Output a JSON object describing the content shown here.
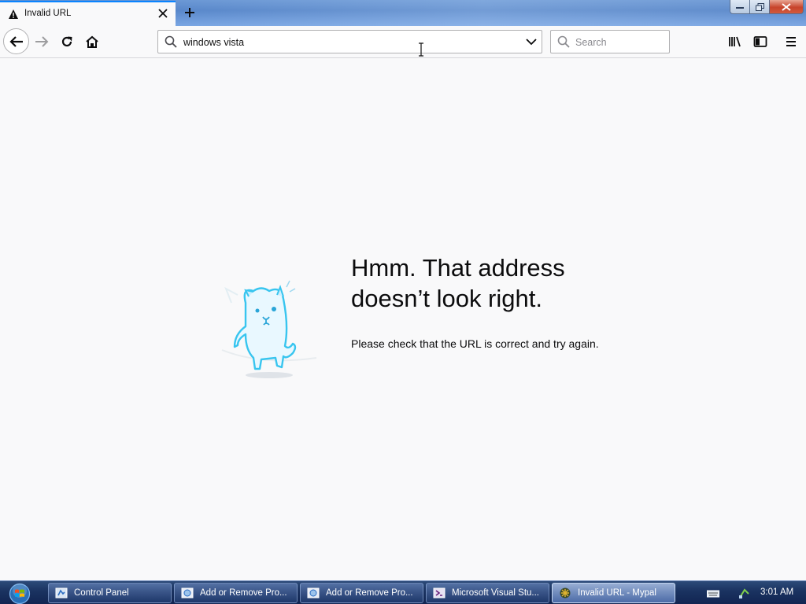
{
  "browser": {
    "tab": {
      "title": "Invalid URL"
    },
    "urlbar": {
      "value": "windows vista"
    },
    "search": {
      "placeholder": "Search"
    }
  },
  "error_page": {
    "heading": "Hmm. That address doesn’t look right.",
    "description": "Please check that the URL is correct and try again."
  },
  "taskbar": {
    "buttons": [
      {
        "label": "Control Panel",
        "icon": "control-panel-icon"
      },
      {
        "label": "Add or Remove Pro...",
        "icon": "programs-icon"
      },
      {
        "label": "Add or Remove Pro...",
        "icon": "programs-icon"
      },
      {
        "label": "Microsoft Visual Stu...",
        "icon": "visual-studio-icon"
      },
      {
        "label": "Invalid URL - Mypal",
        "icon": "mypal-icon"
      }
    ],
    "clock": "3:01 AM"
  },
  "colors": {
    "accent": "#0a84ff",
    "page_bg": "#f9f9fa",
    "taskbar": "#1a3260",
    "close_button": "#c7442b"
  }
}
